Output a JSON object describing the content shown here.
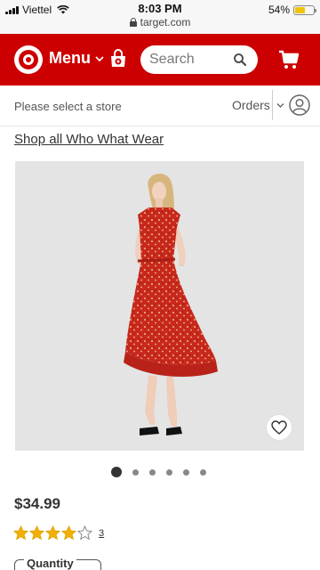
{
  "status_bar": {
    "carrier": "Viettel",
    "time": "8:03 PM",
    "url": "target.com",
    "battery_percent": "54%",
    "battery_level": 0.54
  },
  "header": {
    "logo_icon": "target-bullseye-logo",
    "menu_label": "Menu",
    "search_placeholder": "Search",
    "colors": {
      "brand_red": "#cc0000"
    }
  },
  "store_bar": {
    "store_prompt": "Please select a store",
    "orders_label": "Orders"
  },
  "breadcrumb": {
    "link_text": "Shop all Who What Wear"
  },
  "product": {
    "image_icon": "red-floral-dress-photo",
    "price": "$34.99",
    "rating": 4,
    "rating_max": 5,
    "review_count": "3",
    "image_count": 6,
    "active_image": 1,
    "quantity_label": "Quantity"
  }
}
